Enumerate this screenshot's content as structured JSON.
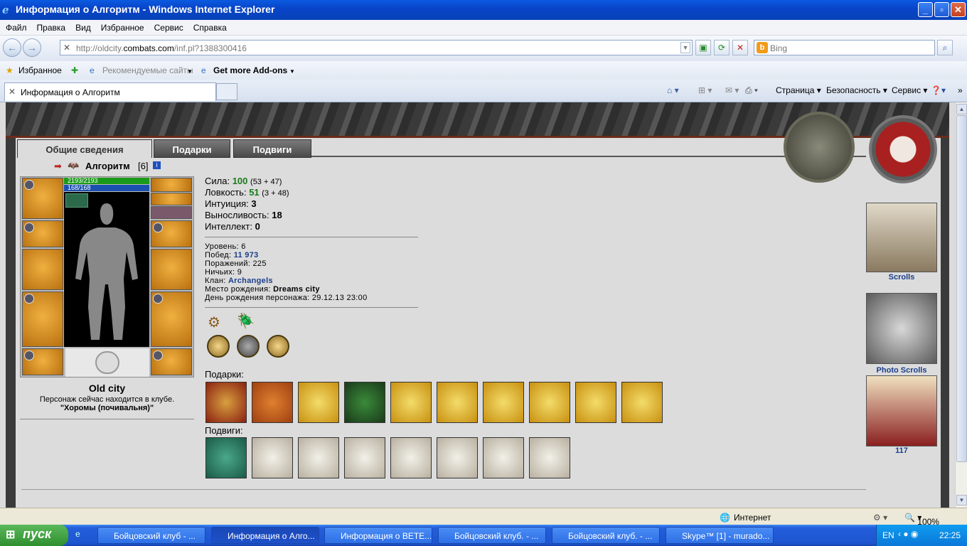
{
  "window": {
    "title": "Информация о Алгоритм - Windows Internet Explorer"
  },
  "menu": [
    "Файл",
    "Правка",
    "Вид",
    "Избранное",
    "Сервис",
    "Справка"
  ],
  "address": {
    "prefix": "http://oldcity.",
    "host": "combats.com",
    "path": "/inf.pl?1388300416"
  },
  "search": {
    "placeholder": "Bing"
  },
  "favorites": {
    "label": "Избранное",
    "recommended": "Рекомендуемые сайты",
    "addons": "Get more Add-ons"
  },
  "tab": {
    "title": "Информация о Алгоритм"
  },
  "toolbar": {
    "page": "Страница",
    "security": "Безопасность",
    "service": "Сервис"
  },
  "page_tabs": [
    "Общие сведения",
    "Подарки",
    "Подвиги"
  ],
  "character": {
    "name": "Алгоритм",
    "level": "[6]",
    "hp": "2193/2193",
    "mana": "168/168",
    "city": "Old city",
    "location_line1": "Персонаж сейчас находится в клубе.",
    "location_line2": "\"Хоромы (почивальня)\""
  },
  "stats": [
    {
      "label": "Сила:",
      "value": "100",
      "extra": "(53 + 47)",
      "green": true
    },
    {
      "label": "Ловкость:",
      "value": "51",
      "extra": "(3 + 48)",
      "green": true
    },
    {
      "label": "Интуиция:",
      "value": "3",
      "extra": "",
      "green": false
    },
    {
      "label": "Выносливость:",
      "value": "18",
      "extra": "",
      "green": false
    },
    {
      "label": "Интеллект:",
      "value": "0",
      "extra": "",
      "green": false
    }
  ],
  "info": {
    "level_label": "Уровень:",
    "level_value": "6",
    "wins_label": "Побед:",
    "wins_value": "11 973",
    "losses_label": "Поражений:",
    "losses_value": "225",
    "draws_label": "Ничьих:",
    "draws_value": "9",
    "clan_label": "Клан:",
    "clan_value": "Archangels",
    "birthplace_label": "Место рождения:",
    "birthplace_value": "Dreams city",
    "birthday_label": "День рождения персонажа:",
    "birthday_value": "29.12.13 23:00"
  },
  "gifts_label": "Подарки:",
  "feats_label": "Подвиги:",
  "sidebar": {
    "scrolls": "Scrolls",
    "photo_scrolls": "Photo Scrolls",
    "count": "117"
  },
  "statusbar": {
    "zone": "Интернет",
    "zoom": "100%"
  },
  "taskbar": {
    "start": "пуск",
    "tasks": [
      "Бойцовский клуб - ...",
      "Информация о Алго...",
      "Информация о BETE...",
      "Бойцовский клуб. - ...",
      "Бойцовский клуб. - ...",
      "Skype™ [1] - murado..."
    ],
    "lang": "EN",
    "time": "22:25"
  }
}
